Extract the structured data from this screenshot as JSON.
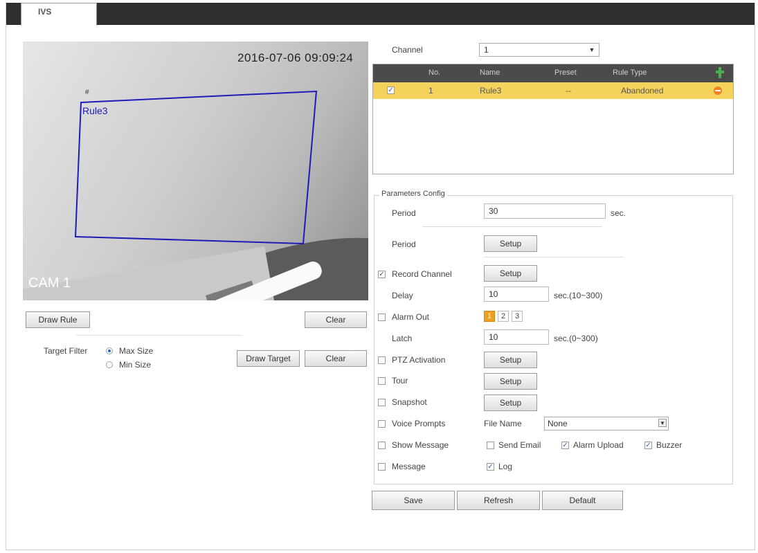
{
  "tab": {
    "label": "IVS"
  },
  "video": {
    "timestamp": "2016-07-06 09:09:24",
    "camera_label": "CAM 1",
    "rule_overlay_label": "Rule3",
    "mark": "#"
  },
  "left_buttons": {
    "draw_rule": "Draw Rule",
    "clear_top": "Clear",
    "draw_target": "Draw Target",
    "clear_bottom": "Clear"
  },
  "target_filter": {
    "label": "Target Filter",
    "options": [
      "Max Size",
      "Min Size"
    ],
    "selected": "Max Size"
  },
  "channel": {
    "label": "Channel",
    "value": "1"
  },
  "rules_table": {
    "headers": [
      "No.",
      "Name",
      "Preset",
      "Rule Type"
    ],
    "rows": [
      {
        "checked": true,
        "no": "1",
        "name": "Rule3",
        "preset": "--",
        "rule_type": "Abandoned"
      }
    ]
  },
  "params": {
    "legend": "Parameters Config",
    "period1": {
      "label": "Period",
      "value": "30",
      "unit": "sec."
    },
    "period2": {
      "label": "Period",
      "button": "Setup"
    },
    "record_channel": {
      "label": "Record Channel",
      "checked": true,
      "button": "Setup"
    },
    "delay": {
      "label": "Delay",
      "value": "10",
      "unit": "sec.(10~300)"
    },
    "alarm_out": {
      "label": "Alarm Out",
      "checked": false,
      "buttons": [
        "1",
        "2",
        "3"
      ],
      "active": "1"
    },
    "latch": {
      "label": "Latch",
      "value": "10",
      "unit": "sec.(0~300)"
    },
    "ptz_activation": {
      "label": "PTZ Activation",
      "checked": false,
      "button": "Setup"
    },
    "tour": {
      "label": "Tour",
      "checked": false,
      "button": "Setup"
    },
    "snapshot": {
      "label": "Snapshot",
      "checked": false,
      "button": "Setup"
    },
    "voice_prompts": {
      "label": "Voice Prompts",
      "checked": false,
      "file_label": "File Name",
      "file_value": "None"
    },
    "show_message": {
      "label": "Show Message",
      "checked": false
    },
    "send_email": {
      "label": "Send Email",
      "checked": false
    },
    "alarm_upload": {
      "label": "Alarm Upload",
      "checked": true
    },
    "buzzer": {
      "label": "Buzzer",
      "checked": true
    },
    "message": {
      "label": "Message",
      "checked": false
    },
    "log": {
      "label": "Log",
      "checked": true
    }
  },
  "footer": {
    "save": "Save",
    "refresh": "Refresh",
    "default": "Default"
  },
  "colors": {
    "row_highlight": "#f5d35a",
    "header_bg": "#4b4b4b",
    "rule_line": "#1c1cb8",
    "add_icon": "#4caf50",
    "delete_icon": "#f08020",
    "alarm_active": "#f0a020"
  }
}
